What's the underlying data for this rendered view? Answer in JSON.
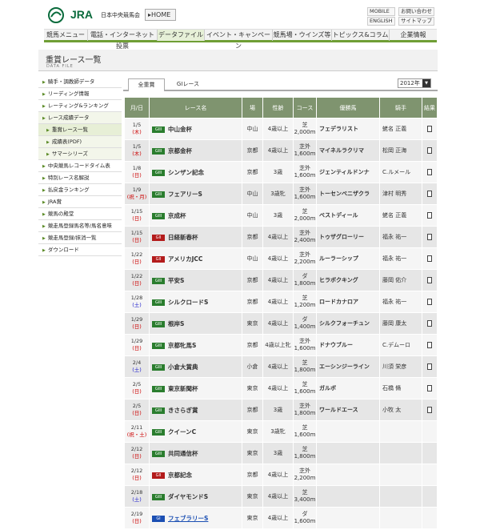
{
  "header": {
    "logo_text": "JRA",
    "org_name": "日本中央競馬会",
    "home_label": "HOME",
    "util_links": [
      "MOBILE",
      "ENGLISH",
      "お問い合わせ",
      "サイトマップ"
    ]
  },
  "nav": {
    "items": [
      "競馬メニュー",
      "電話・インターネット投票",
      "データファイル",
      "イベント・キャンペーン",
      "競馬場・ウインズ等",
      "トピックス&コラム",
      "企業情報"
    ],
    "active": "データファイル"
  },
  "page": {
    "title": "重賞レース一覧",
    "subtitle": "DATA FILE"
  },
  "sidebar": {
    "items": [
      {
        "label": "騎手・調教師データ",
        "level": 0
      },
      {
        "label": "リーディング情報",
        "level": 0
      },
      {
        "label": "レーティング&ランキング",
        "level": 0
      },
      {
        "label": "レース成績データ",
        "level": 0
      },
      {
        "label": "重賞レース一覧",
        "level": 1
      },
      {
        "label": "成績表(PDF)",
        "level": 1
      },
      {
        "label": "サマーシリーズ",
        "level": 1
      },
      {
        "label": "中央競馬レコードタイム表",
        "level": 0
      },
      {
        "label": "特別レース名解説",
        "level": 0
      },
      {
        "label": "払戻金ランキング",
        "level": 0
      },
      {
        "label": "JRA賞",
        "level": 0
      },
      {
        "label": "競馬の殿堂",
        "level": 0
      },
      {
        "label": "競走馬登録馬名等/馬名意味",
        "level": 0
      },
      {
        "label": "競走馬登録/抹消一覧",
        "level": 0
      },
      {
        "label": "ダウンロード",
        "level": 0
      }
    ]
  },
  "tabs": [
    "全重賞",
    "GIレース"
  ],
  "year_select": "2012年",
  "table": {
    "headers": [
      "月/日",
      "レース名",
      "場",
      "性齢",
      "コース",
      "優勝馬",
      "騎手",
      "結果"
    ],
    "rows": [
      {
        "date": "1/5",
        "dow": "(木)",
        "grade": "GIII",
        "race": "中山金杯",
        "venue": "中山",
        "age": "4歳以上",
        "course1": "芝",
        "course2": "2,000m",
        "winner": "フェデラリスト",
        "jockey": "蛯名 正義"
      },
      {
        "date": "1/5",
        "dow": "(木)",
        "grade": "GIII",
        "race": "京都金杯",
        "venue": "京都",
        "age": "4歳以上",
        "course1": "芝外",
        "course2": "1,600m",
        "winner": "マイネルラクリマ",
        "jockey": "松岡 正海"
      },
      {
        "date": "1/8",
        "dow": "(日)",
        "grade": "GIII",
        "race": "シンザン記念",
        "venue": "京都",
        "age": "3歳",
        "course1": "芝外",
        "course2": "1,600m",
        "winner": "ジェンティルドンナ",
        "jockey": "C.ルメール"
      },
      {
        "date": "1/9",
        "dow": "(祝・月)",
        "grade": "GIII",
        "race": "フェアリーS",
        "venue": "中山",
        "age": "3歳牝",
        "course1": "芝外",
        "course2": "1,600m",
        "winner": "トーセンベニザクラ",
        "jockey": "津村 明秀"
      },
      {
        "date": "1/15",
        "dow": "(日)",
        "grade": "GIII",
        "race": "京成杯",
        "venue": "中山",
        "age": "3歳",
        "course1": "芝",
        "course2": "2,000m",
        "winner": "ベストディール",
        "jockey": "蛯名 正義"
      },
      {
        "date": "1/15",
        "dow": "(日)",
        "grade": "GII",
        "race": "日経新春杯",
        "venue": "京都",
        "age": "4歳以上",
        "course1": "芝外",
        "course2": "2,400m",
        "winner": "トゥザグローリー",
        "jockey": "福永 祐一"
      },
      {
        "date": "1/22",
        "dow": "(日)",
        "grade": "GII",
        "race": "アメリカJCC",
        "venue": "中山",
        "age": "4歳以上",
        "course1": "芝外",
        "course2": "2,200m",
        "winner": "ルーラーシップ",
        "jockey": "福永 祐一"
      },
      {
        "date": "1/22",
        "dow": "(日)",
        "grade": "GIII",
        "race": "平安S",
        "venue": "京都",
        "age": "4歳以上",
        "course1": "ダ",
        "course2": "1,800m",
        "winner": "ヒラボクキング",
        "jockey": "藤岡 佑介"
      },
      {
        "date": "1/28",
        "dow": "(土)",
        "grade": "GIII",
        "race": "シルクロードS",
        "venue": "京都",
        "age": "4歳以上",
        "course1": "芝",
        "course2": "1,200m",
        "winner": "ロードカナロア",
        "jockey": "福永 祐一"
      },
      {
        "date": "1/29",
        "dow": "(日)",
        "grade": "GIII",
        "race": "根岸S",
        "venue": "東京",
        "age": "4歳以上",
        "course1": "ダ",
        "course2": "1,400m",
        "winner": "シルクフォーチュン",
        "jockey": "藤岡 康太"
      },
      {
        "date": "1/29",
        "dow": "(日)",
        "grade": "GIII",
        "race": "京都牝馬S",
        "venue": "京都",
        "age": "4歳以上牝",
        "course1": "芝外",
        "course2": "1,600m",
        "winner": "ドナウブルー",
        "jockey": "C.デムーロ"
      },
      {
        "date": "2/4",
        "dow": "(土)",
        "grade": "GIII",
        "race": "小倉大賞典",
        "venue": "小倉",
        "age": "4歳以上",
        "course1": "芝",
        "course2": "1,800m",
        "winner": "エーシンジーライン",
        "jockey": "川須 栄彦"
      },
      {
        "date": "2/5",
        "dow": "(日)",
        "grade": "GIII",
        "race": "東京新聞杯",
        "venue": "東京",
        "age": "4歳以上",
        "course1": "芝",
        "course2": "1,600m",
        "winner": "ガルボ",
        "jockey": "石橋 脩"
      },
      {
        "date": "2/5",
        "dow": "(日)",
        "grade": "GIII",
        "race": "きさらぎ賞",
        "venue": "京都",
        "age": "3歳",
        "course1": "芝外",
        "course2": "1,800m",
        "winner": "ワールドエース",
        "jockey": "小牧 太"
      },
      {
        "date": "2/11",
        "dow": "(祝・土)",
        "grade": "GIII",
        "race": "クイーンC",
        "venue": "東京",
        "age": "3歳牝",
        "course1": "芝",
        "course2": "1,600m",
        "winner": "",
        "jockey": ""
      },
      {
        "date": "2/12",
        "dow": "(日)",
        "grade": "GIII",
        "race": "共同通信杯",
        "venue": "東京",
        "age": "3歳",
        "course1": "芝",
        "course2": "1,800m",
        "winner": "",
        "jockey": ""
      },
      {
        "date": "2/12",
        "dow": "(日)",
        "grade": "GII",
        "race": "京都記念",
        "venue": "京都",
        "age": "4歳以上",
        "course1": "芝外",
        "course2": "2,200m",
        "winner": "",
        "jockey": ""
      },
      {
        "date": "2/18",
        "dow": "(土)",
        "grade": "GIII",
        "race": "ダイヤモンドS",
        "venue": "東京",
        "age": "4歳以上",
        "course1": "芝",
        "course2": "3,400m",
        "winner": "",
        "jockey": ""
      },
      {
        "date": "2/19",
        "dow": "(日)",
        "grade": "GI",
        "race": "フェブラリーS",
        "venue": "東京",
        "age": "4歳以上",
        "course1": "ダ",
        "course2": "1,600m",
        "winner": "",
        "jockey": ""
      }
    ]
  },
  "colors": {
    "accent_green": "#6f9e35",
    "header_gray": "#7f946f",
    "g3_badge": "#2a7d2e",
    "g2_badge": "#b31b1b",
    "g1_badge": "#1b4fb3"
  }
}
